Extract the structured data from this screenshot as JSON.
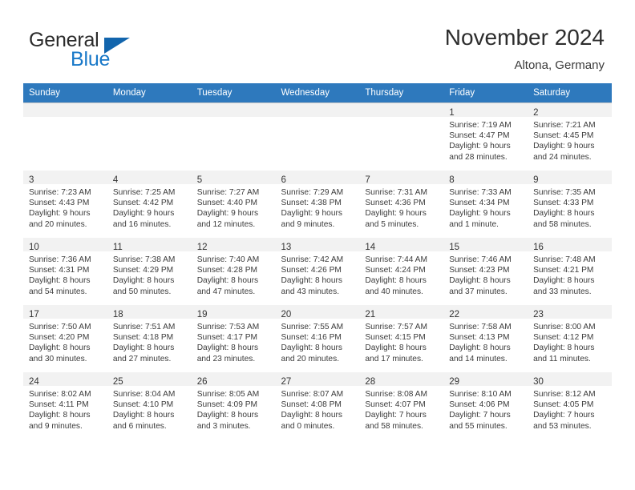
{
  "brand": {
    "name_part1": "General",
    "name_part2": "Blue",
    "flag_icon": "triangle-flag-icon"
  },
  "header": {
    "title": "November 2024",
    "location": "Altona, Germany"
  },
  "colors": {
    "header_blue": "#2e79bd",
    "brand_blue": "#1878c8",
    "daynum_band": "#f2f2f2",
    "grid_line": "#c8c8c8"
  },
  "weekday_headers": [
    "Sunday",
    "Monday",
    "Tuesday",
    "Wednesday",
    "Thursday",
    "Friday",
    "Saturday"
  ],
  "weeks": [
    [
      {
        "day": "",
        "empty": true,
        "lines": []
      },
      {
        "day": "",
        "empty": true,
        "lines": []
      },
      {
        "day": "",
        "empty": true,
        "lines": []
      },
      {
        "day": "",
        "empty": true,
        "lines": []
      },
      {
        "day": "",
        "empty": true,
        "lines": []
      },
      {
        "day": "1",
        "empty": false,
        "lines": [
          "Sunrise: 7:19 AM",
          "Sunset: 4:47 PM",
          "Daylight: 9 hours",
          "and 28 minutes."
        ]
      },
      {
        "day": "2",
        "empty": false,
        "lines": [
          "Sunrise: 7:21 AM",
          "Sunset: 4:45 PM",
          "Daylight: 9 hours",
          "and 24 minutes."
        ]
      }
    ],
    [
      {
        "day": "3",
        "empty": false,
        "lines": [
          "Sunrise: 7:23 AM",
          "Sunset: 4:43 PM",
          "Daylight: 9 hours",
          "and 20 minutes."
        ]
      },
      {
        "day": "4",
        "empty": false,
        "lines": [
          "Sunrise: 7:25 AM",
          "Sunset: 4:42 PM",
          "Daylight: 9 hours",
          "and 16 minutes."
        ]
      },
      {
        "day": "5",
        "empty": false,
        "lines": [
          "Sunrise: 7:27 AM",
          "Sunset: 4:40 PM",
          "Daylight: 9 hours",
          "and 12 minutes."
        ]
      },
      {
        "day": "6",
        "empty": false,
        "lines": [
          "Sunrise: 7:29 AM",
          "Sunset: 4:38 PM",
          "Daylight: 9 hours",
          "and 9 minutes."
        ]
      },
      {
        "day": "7",
        "empty": false,
        "lines": [
          "Sunrise: 7:31 AM",
          "Sunset: 4:36 PM",
          "Daylight: 9 hours",
          "and 5 minutes."
        ]
      },
      {
        "day": "8",
        "empty": false,
        "lines": [
          "Sunrise: 7:33 AM",
          "Sunset: 4:34 PM",
          "Daylight: 9 hours",
          "and 1 minute."
        ]
      },
      {
        "day": "9",
        "empty": false,
        "lines": [
          "Sunrise: 7:35 AM",
          "Sunset: 4:33 PM",
          "Daylight: 8 hours",
          "and 58 minutes."
        ]
      }
    ],
    [
      {
        "day": "10",
        "empty": false,
        "lines": [
          "Sunrise: 7:36 AM",
          "Sunset: 4:31 PM",
          "Daylight: 8 hours",
          "and 54 minutes."
        ]
      },
      {
        "day": "11",
        "empty": false,
        "lines": [
          "Sunrise: 7:38 AM",
          "Sunset: 4:29 PM",
          "Daylight: 8 hours",
          "and 50 minutes."
        ]
      },
      {
        "day": "12",
        "empty": false,
        "lines": [
          "Sunrise: 7:40 AM",
          "Sunset: 4:28 PM",
          "Daylight: 8 hours",
          "and 47 minutes."
        ]
      },
      {
        "day": "13",
        "empty": false,
        "lines": [
          "Sunrise: 7:42 AM",
          "Sunset: 4:26 PM",
          "Daylight: 8 hours",
          "and 43 minutes."
        ]
      },
      {
        "day": "14",
        "empty": false,
        "lines": [
          "Sunrise: 7:44 AM",
          "Sunset: 4:24 PM",
          "Daylight: 8 hours",
          "and 40 minutes."
        ]
      },
      {
        "day": "15",
        "empty": false,
        "lines": [
          "Sunrise: 7:46 AM",
          "Sunset: 4:23 PM",
          "Daylight: 8 hours",
          "and 37 minutes."
        ]
      },
      {
        "day": "16",
        "empty": false,
        "lines": [
          "Sunrise: 7:48 AM",
          "Sunset: 4:21 PM",
          "Daylight: 8 hours",
          "and 33 minutes."
        ]
      }
    ],
    [
      {
        "day": "17",
        "empty": false,
        "lines": [
          "Sunrise: 7:50 AM",
          "Sunset: 4:20 PM",
          "Daylight: 8 hours",
          "and 30 minutes."
        ]
      },
      {
        "day": "18",
        "empty": false,
        "lines": [
          "Sunrise: 7:51 AM",
          "Sunset: 4:18 PM",
          "Daylight: 8 hours",
          "and 27 minutes."
        ]
      },
      {
        "day": "19",
        "empty": false,
        "lines": [
          "Sunrise: 7:53 AM",
          "Sunset: 4:17 PM",
          "Daylight: 8 hours",
          "and 23 minutes."
        ]
      },
      {
        "day": "20",
        "empty": false,
        "lines": [
          "Sunrise: 7:55 AM",
          "Sunset: 4:16 PM",
          "Daylight: 8 hours",
          "and 20 minutes."
        ]
      },
      {
        "day": "21",
        "empty": false,
        "lines": [
          "Sunrise: 7:57 AM",
          "Sunset: 4:15 PM",
          "Daylight: 8 hours",
          "and 17 minutes."
        ]
      },
      {
        "day": "22",
        "empty": false,
        "lines": [
          "Sunrise: 7:58 AM",
          "Sunset: 4:13 PM",
          "Daylight: 8 hours",
          "and 14 minutes."
        ]
      },
      {
        "day": "23",
        "empty": false,
        "lines": [
          "Sunrise: 8:00 AM",
          "Sunset: 4:12 PM",
          "Daylight: 8 hours",
          "and 11 minutes."
        ]
      }
    ],
    [
      {
        "day": "24",
        "empty": false,
        "lines": [
          "Sunrise: 8:02 AM",
          "Sunset: 4:11 PM",
          "Daylight: 8 hours",
          "and 9 minutes."
        ]
      },
      {
        "day": "25",
        "empty": false,
        "lines": [
          "Sunrise: 8:04 AM",
          "Sunset: 4:10 PM",
          "Daylight: 8 hours",
          "and 6 minutes."
        ]
      },
      {
        "day": "26",
        "empty": false,
        "lines": [
          "Sunrise: 8:05 AM",
          "Sunset: 4:09 PM",
          "Daylight: 8 hours",
          "and 3 minutes."
        ]
      },
      {
        "day": "27",
        "empty": false,
        "lines": [
          "Sunrise: 8:07 AM",
          "Sunset: 4:08 PM",
          "Daylight: 8 hours",
          "and 0 minutes."
        ]
      },
      {
        "day": "28",
        "empty": false,
        "lines": [
          "Sunrise: 8:08 AM",
          "Sunset: 4:07 PM",
          "Daylight: 7 hours",
          "and 58 minutes."
        ]
      },
      {
        "day": "29",
        "empty": false,
        "lines": [
          "Sunrise: 8:10 AM",
          "Sunset: 4:06 PM",
          "Daylight: 7 hours",
          "and 55 minutes."
        ]
      },
      {
        "day": "30",
        "empty": false,
        "lines": [
          "Sunrise: 8:12 AM",
          "Sunset: 4:05 PM",
          "Daylight: 7 hours",
          "and 53 minutes."
        ]
      }
    ]
  ]
}
